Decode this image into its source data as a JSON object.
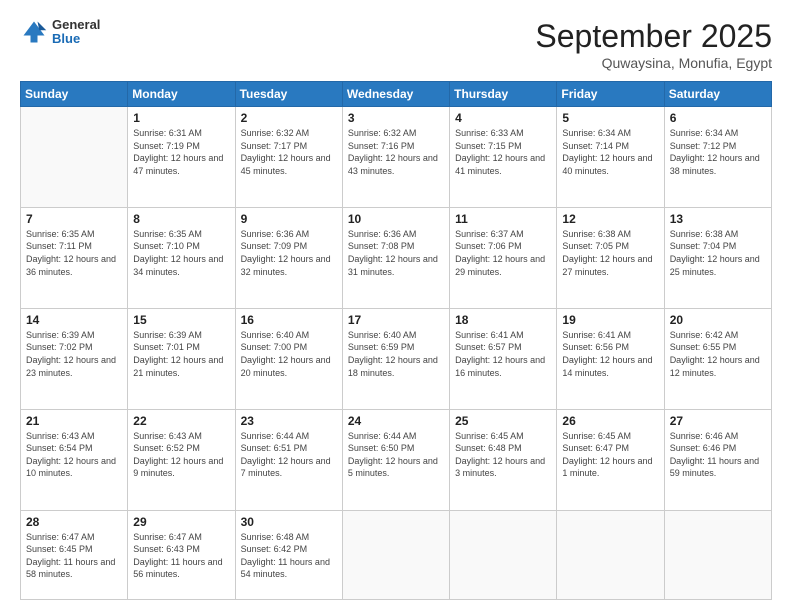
{
  "header": {
    "logo_general": "General",
    "logo_blue": "Blue",
    "month_title": "September 2025",
    "location": "Quwaysina, Monufia, Egypt"
  },
  "weekdays": [
    "Sunday",
    "Monday",
    "Tuesday",
    "Wednesday",
    "Thursday",
    "Friday",
    "Saturday"
  ],
  "weeks": [
    [
      {
        "day": "",
        "sunrise": "",
        "sunset": "",
        "daylight": ""
      },
      {
        "day": "1",
        "sunrise": "Sunrise: 6:31 AM",
        "sunset": "Sunset: 7:19 PM",
        "daylight": "Daylight: 12 hours and 47 minutes."
      },
      {
        "day": "2",
        "sunrise": "Sunrise: 6:32 AM",
        "sunset": "Sunset: 7:17 PM",
        "daylight": "Daylight: 12 hours and 45 minutes."
      },
      {
        "day": "3",
        "sunrise": "Sunrise: 6:32 AM",
        "sunset": "Sunset: 7:16 PM",
        "daylight": "Daylight: 12 hours and 43 minutes."
      },
      {
        "day": "4",
        "sunrise": "Sunrise: 6:33 AM",
        "sunset": "Sunset: 7:15 PM",
        "daylight": "Daylight: 12 hours and 41 minutes."
      },
      {
        "day": "5",
        "sunrise": "Sunrise: 6:34 AM",
        "sunset": "Sunset: 7:14 PM",
        "daylight": "Daylight: 12 hours and 40 minutes."
      },
      {
        "day": "6",
        "sunrise": "Sunrise: 6:34 AM",
        "sunset": "Sunset: 7:12 PM",
        "daylight": "Daylight: 12 hours and 38 minutes."
      }
    ],
    [
      {
        "day": "7",
        "sunrise": "Sunrise: 6:35 AM",
        "sunset": "Sunset: 7:11 PM",
        "daylight": "Daylight: 12 hours and 36 minutes."
      },
      {
        "day": "8",
        "sunrise": "Sunrise: 6:35 AM",
        "sunset": "Sunset: 7:10 PM",
        "daylight": "Daylight: 12 hours and 34 minutes."
      },
      {
        "day": "9",
        "sunrise": "Sunrise: 6:36 AM",
        "sunset": "Sunset: 7:09 PM",
        "daylight": "Daylight: 12 hours and 32 minutes."
      },
      {
        "day": "10",
        "sunrise": "Sunrise: 6:36 AM",
        "sunset": "Sunset: 7:08 PM",
        "daylight": "Daylight: 12 hours and 31 minutes."
      },
      {
        "day": "11",
        "sunrise": "Sunrise: 6:37 AM",
        "sunset": "Sunset: 7:06 PM",
        "daylight": "Daylight: 12 hours and 29 minutes."
      },
      {
        "day": "12",
        "sunrise": "Sunrise: 6:38 AM",
        "sunset": "Sunset: 7:05 PM",
        "daylight": "Daylight: 12 hours and 27 minutes."
      },
      {
        "day": "13",
        "sunrise": "Sunrise: 6:38 AM",
        "sunset": "Sunset: 7:04 PM",
        "daylight": "Daylight: 12 hours and 25 minutes."
      }
    ],
    [
      {
        "day": "14",
        "sunrise": "Sunrise: 6:39 AM",
        "sunset": "Sunset: 7:02 PM",
        "daylight": "Daylight: 12 hours and 23 minutes."
      },
      {
        "day": "15",
        "sunrise": "Sunrise: 6:39 AM",
        "sunset": "Sunset: 7:01 PM",
        "daylight": "Daylight: 12 hours and 21 minutes."
      },
      {
        "day": "16",
        "sunrise": "Sunrise: 6:40 AM",
        "sunset": "Sunset: 7:00 PM",
        "daylight": "Daylight: 12 hours and 20 minutes."
      },
      {
        "day": "17",
        "sunrise": "Sunrise: 6:40 AM",
        "sunset": "Sunset: 6:59 PM",
        "daylight": "Daylight: 12 hours and 18 minutes."
      },
      {
        "day": "18",
        "sunrise": "Sunrise: 6:41 AM",
        "sunset": "Sunset: 6:57 PM",
        "daylight": "Daylight: 12 hours and 16 minutes."
      },
      {
        "day": "19",
        "sunrise": "Sunrise: 6:41 AM",
        "sunset": "Sunset: 6:56 PM",
        "daylight": "Daylight: 12 hours and 14 minutes."
      },
      {
        "day": "20",
        "sunrise": "Sunrise: 6:42 AM",
        "sunset": "Sunset: 6:55 PM",
        "daylight": "Daylight: 12 hours and 12 minutes."
      }
    ],
    [
      {
        "day": "21",
        "sunrise": "Sunrise: 6:43 AM",
        "sunset": "Sunset: 6:54 PM",
        "daylight": "Daylight: 12 hours and 10 minutes."
      },
      {
        "day": "22",
        "sunrise": "Sunrise: 6:43 AM",
        "sunset": "Sunset: 6:52 PM",
        "daylight": "Daylight: 12 hours and 9 minutes."
      },
      {
        "day": "23",
        "sunrise": "Sunrise: 6:44 AM",
        "sunset": "Sunset: 6:51 PM",
        "daylight": "Daylight: 12 hours and 7 minutes."
      },
      {
        "day": "24",
        "sunrise": "Sunrise: 6:44 AM",
        "sunset": "Sunset: 6:50 PM",
        "daylight": "Daylight: 12 hours and 5 minutes."
      },
      {
        "day": "25",
        "sunrise": "Sunrise: 6:45 AM",
        "sunset": "Sunset: 6:48 PM",
        "daylight": "Daylight: 12 hours and 3 minutes."
      },
      {
        "day": "26",
        "sunrise": "Sunrise: 6:45 AM",
        "sunset": "Sunset: 6:47 PM",
        "daylight": "Daylight: 12 hours and 1 minute."
      },
      {
        "day": "27",
        "sunrise": "Sunrise: 6:46 AM",
        "sunset": "Sunset: 6:46 PM",
        "daylight": "Daylight: 11 hours and 59 minutes."
      }
    ],
    [
      {
        "day": "28",
        "sunrise": "Sunrise: 6:47 AM",
        "sunset": "Sunset: 6:45 PM",
        "daylight": "Daylight: 11 hours and 58 minutes."
      },
      {
        "day": "29",
        "sunrise": "Sunrise: 6:47 AM",
        "sunset": "Sunset: 6:43 PM",
        "daylight": "Daylight: 11 hours and 56 minutes."
      },
      {
        "day": "30",
        "sunrise": "Sunrise: 6:48 AM",
        "sunset": "Sunset: 6:42 PM",
        "daylight": "Daylight: 11 hours and 54 minutes."
      },
      {
        "day": "",
        "sunrise": "",
        "sunset": "",
        "daylight": ""
      },
      {
        "day": "",
        "sunrise": "",
        "sunset": "",
        "daylight": ""
      },
      {
        "day": "",
        "sunrise": "",
        "sunset": "",
        "daylight": ""
      },
      {
        "day": "",
        "sunrise": "",
        "sunset": "",
        "daylight": ""
      }
    ]
  ]
}
